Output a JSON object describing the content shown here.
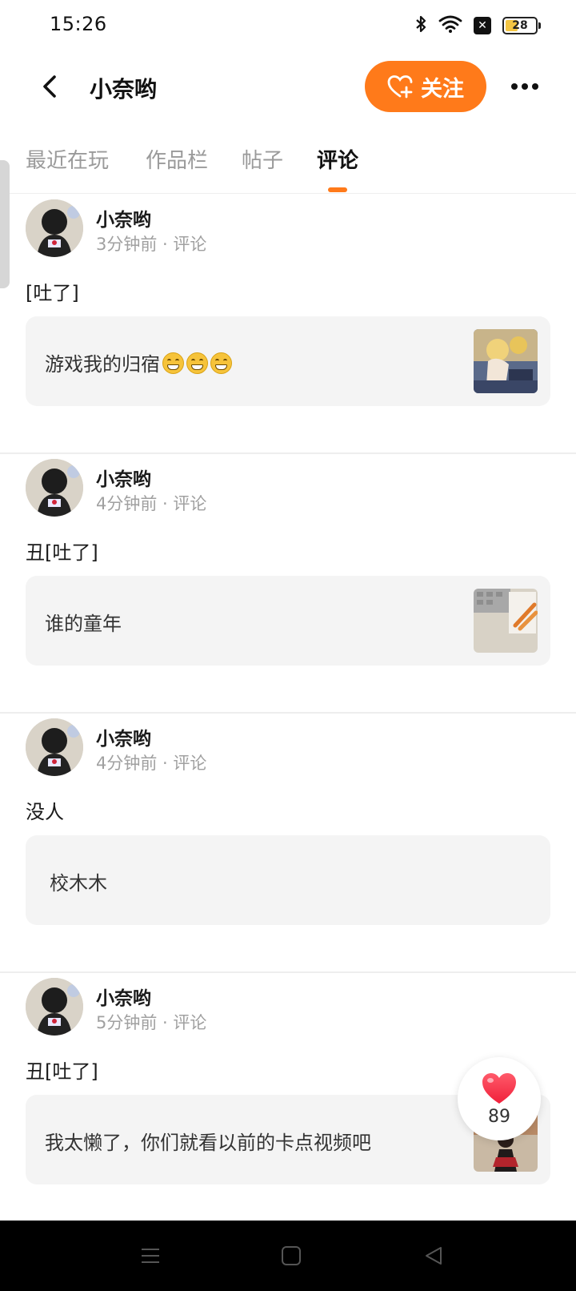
{
  "status_bar": {
    "time": "15:26",
    "battery": "28",
    "icons": [
      "bluetooth-icon",
      "wifi-icon",
      "notification-x-icon",
      "battery-icon"
    ]
  },
  "header": {
    "title": "小奈哟",
    "follow_label": "关注",
    "accent_color": "#ff7a1a"
  },
  "tabs": [
    {
      "label": "最近在玩",
      "active": false
    },
    {
      "label": "作品栏",
      "active": false
    },
    {
      "label": "帖子",
      "active": false
    },
    {
      "label": "评论",
      "active": true
    }
  ],
  "posts": [
    {
      "name": "小奈哟",
      "time": "3分钟前",
      "type": "评论",
      "text": "[吐了]",
      "quote": "游戏我的归宿"
    },
    {
      "name": "小奈哟",
      "time": "4分钟前",
      "type": "评论",
      "text": "丑[吐了]",
      "quote": "谁的童年"
    },
    {
      "name": "小奈哟",
      "time": "4分钟前",
      "type": "评论",
      "text": "没人",
      "quote": "校木木"
    },
    {
      "name": "小奈哟",
      "time": "5分钟前",
      "type": "评论",
      "text": "丑[吐了]",
      "quote": "我太懒了，你们就看以前的卡点视频吧"
    }
  ],
  "meta_separator": " · ",
  "like_float": {
    "count": "89"
  }
}
